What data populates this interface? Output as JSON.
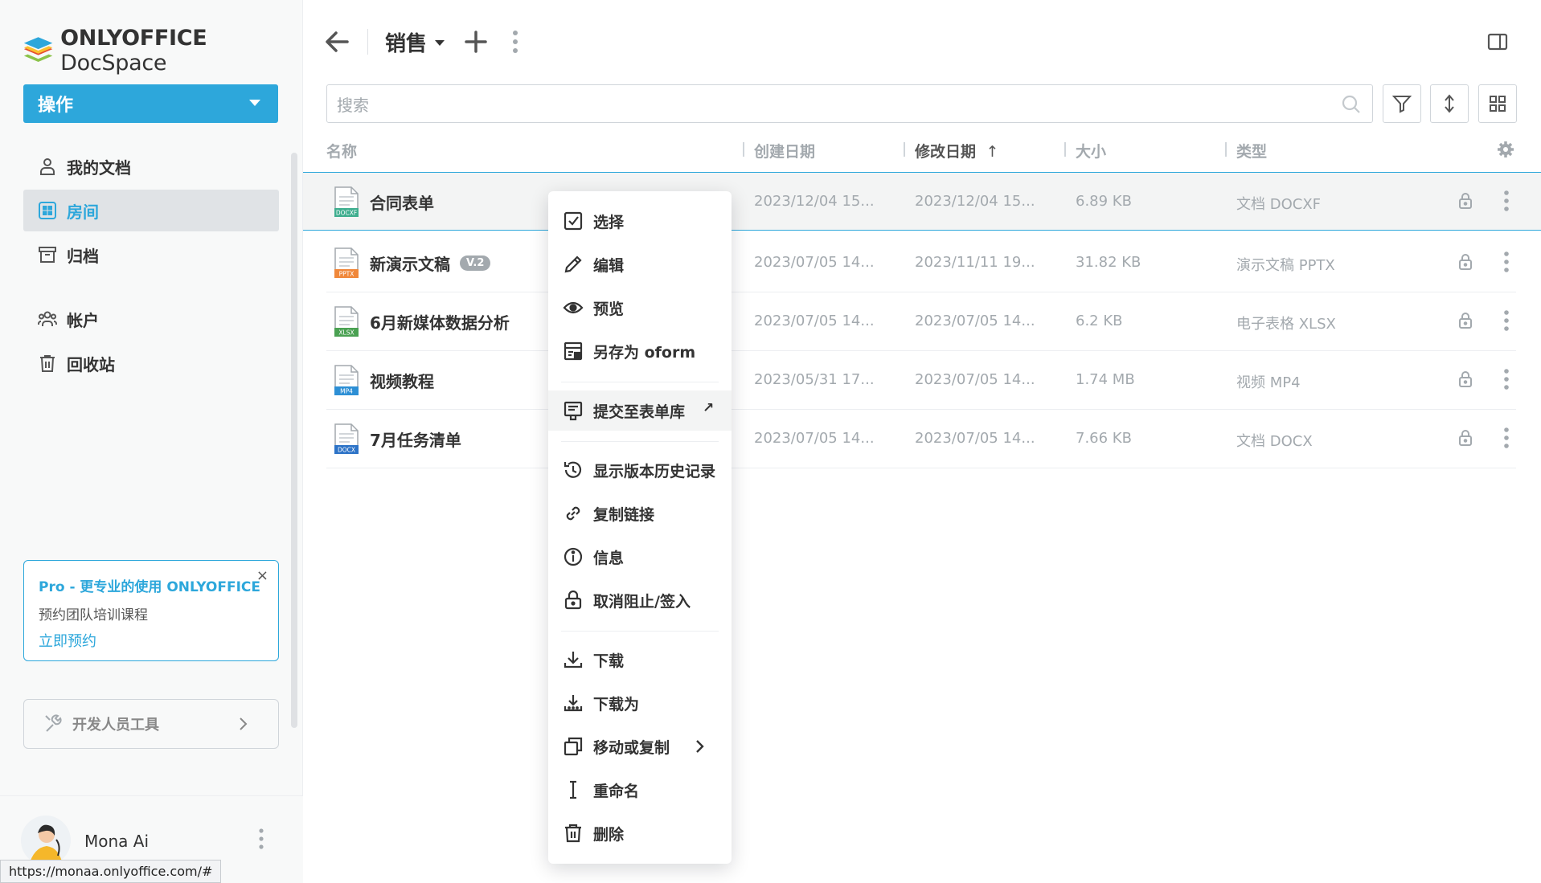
{
  "brand": {
    "name_bold": "ONLYOFFICE",
    "name_rest": " DocSpace"
  },
  "sidebar": {
    "action_label": "操作",
    "items": [
      {
        "label": "我的文档",
        "icon": "person-icon"
      },
      {
        "label": "房间",
        "icon": "rooms-icon",
        "active": true
      },
      {
        "label": "归档",
        "icon": "archive-icon"
      },
      {
        "label": "帐户",
        "icon": "accounts-icon"
      },
      {
        "label": "回收站",
        "icon": "trash-icon"
      }
    ],
    "promo": {
      "title": "Pro - 更专业的使用 ONLYOFFICE",
      "subtitle": "预约团队培训课程",
      "link": "立即预约",
      "close": "×"
    },
    "devtools_label": "开发人员工具",
    "user_name": "Mona Ai",
    "status_url": "https://monaa.onlyoffice.com/#"
  },
  "header": {
    "title": "销售"
  },
  "search": {
    "placeholder": "搜索"
  },
  "columns": {
    "name": "名称",
    "created": "创建日期",
    "modified": "修改日期",
    "modified_sort": "↑",
    "size": "大小",
    "type": "类型"
  },
  "files": [
    {
      "name": "合同表单",
      "ext": "DOCXF",
      "ext_color": "#3fae8f",
      "created": "2023/12/04 15...",
      "modified": "2023/12/04 15...",
      "size": "6.89 KB",
      "type": "文档 DOCXF",
      "selected": true
    },
    {
      "name": "新演示文稿",
      "ext": "PPTX",
      "ext_color": "#f0883b",
      "version": "V.2",
      "created": "2023/07/05 14...",
      "modified": "2023/11/11 19...",
      "size": "31.82 KB",
      "type": "演示文稿 PPTX"
    },
    {
      "name": "6月新媒体数据分析",
      "ext": "XLSX",
      "ext_color": "#4aa152",
      "created": "2023/07/05 14...",
      "modified": "2023/07/05 14...",
      "size": "6.2 KB",
      "type": "电子表格 XLSX"
    },
    {
      "name": "视频教程",
      "ext": "MP4",
      "ext_color": "#2d8fd5",
      "created": "2023/05/31 17...",
      "modified": "2023/07/05 14...",
      "size": "1.74 MB",
      "type": "视频 MP4"
    },
    {
      "name": "7月任务清单",
      "ext": "DOCX",
      "ext_color": "#2d73c7",
      "created": "2023/07/05 14...",
      "modified": "2023/07/05 14...",
      "size": "7.66 KB",
      "type": "文档 DOCX"
    }
  ],
  "context_menu": {
    "items": [
      {
        "label": "选择",
        "icon": "checkbox-icon"
      },
      {
        "label": "编辑",
        "icon": "pencil-icon"
      },
      {
        "label": "预览",
        "icon": "eye-icon"
      },
      {
        "label": "另存为 oform",
        "icon": "save-form-icon"
      },
      {
        "label": "提交至表单库",
        "icon": "submit-form-icon",
        "external": "↗"
      },
      {
        "label": "显示版本历史记录",
        "icon": "history-icon"
      },
      {
        "label": "复制链接",
        "icon": "link-icon"
      },
      {
        "label": "信息",
        "icon": "info-icon"
      },
      {
        "label": "取消阻止/签入",
        "icon": "lock-icon"
      },
      {
        "label": "下载",
        "icon": "download-icon"
      },
      {
        "label": "下载为",
        "icon": "download-as-icon"
      },
      {
        "label": "移动或复制",
        "icon": "copy-icon"
      },
      {
        "label": "重命名",
        "icon": "rename-icon"
      },
      {
        "label": "删除",
        "icon": "delete-icon"
      }
    ]
  }
}
